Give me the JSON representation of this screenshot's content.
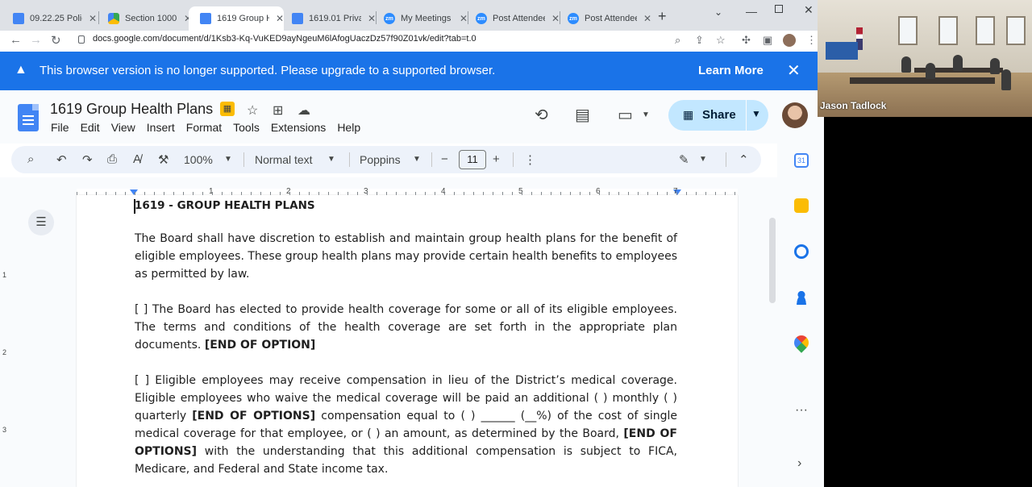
{
  "browser": {
    "tabs": [
      {
        "title": "09.22.25 Polic",
        "icon": "docs-icon",
        "favtype": "doc"
      },
      {
        "title": "Section 1000",
        "icon": "drive-icon",
        "favtype": "drive"
      },
      {
        "title": "1619 Group H",
        "icon": "docs-icon",
        "favtype": "doc"
      },
      {
        "title": "1619.01 Privac",
        "icon": "docs-icon",
        "favtype": "doc"
      },
      {
        "title": "My Meetings",
        "icon": "zoom-icon",
        "favtype": "zoom"
      },
      {
        "title": "Post Attendee",
        "icon": "zoom-icon",
        "favtype": "zoom"
      },
      {
        "title": "Post Attendee",
        "icon": "zoom-icon",
        "favtype": "zoom"
      }
    ],
    "active_tab_index": 2,
    "url": "docs.google.com/document/d/1Ksb3-Kq-VuKED9ayNgeuM6lAfogUaczDz57f90Z01vk/edit?tab=t.0"
  },
  "banner": {
    "message": "This browser version is no longer supported. Please upgrade to a supported browser.",
    "learn_more": "Learn More"
  },
  "docs": {
    "title": "1619 Group Health Plans",
    "menus": [
      "File",
      "Edit",
      "View",
      "Insert",
      "Format",
      "Tools",
      "Extensions",
      "Help"
    ],
    "share_label": "Share",
    "zoom": "100%",
    "style": "Normal text",
    "font": "Poppins",
    "font_size": "11"
  },
  "ruler": {
    "numbers": [
      "1",
      "2",
      "3",
      "4",
      "5",
      "6",
      "7"
    ]
  },
  "vruler": {
    "numbers": [
      "1",
      "2",
      "3"
    ]
  },
  "document": {
    "heading": "1619 - GROUP HEALTH PLANS",
    "p1": "The Board shall have discretion to establish and maintain group health plans for the benefit of eligible employees. These group health plans may provide certain health benefits to employees as permitted by law.",
    "p2_text": "[ ]  The Board has elected to provide health coverage for some or all of its eligible employees. The terms and conditions of the health coverage are set forth in the appropriate plan documents. ",
    "p2_bold": "[END OF OPTION]",
    "p3_a": "[ ]  Eligible employees may receive compensation in lieu of the District’s medical coverage. Eligible employees who waive the medical coverage will be paid an additional ( ) monthly ( ) quarterly ",
    "p3_b": "[END OF OPTIONS]",
    "p3_c": " compensation equal to ( ) ______ (__%) of the cost of single medical coverage for that employee, or ( ) an amount, as determined by the Board, ",
    "p3_d": "[END OF OPTIONS]",
    "p3_e": " with the understanding that this additional compensation is subject to FICA, Medicare, and Federal and State income tax."
  },
  "video": {
    "participant_name": "Jason Tadlock"
  },
  "colors": {
    "banner": "#1a73e8",
    "share": "#c2e7ff",
    "toolbar": "#edf2fa"
  }
}
